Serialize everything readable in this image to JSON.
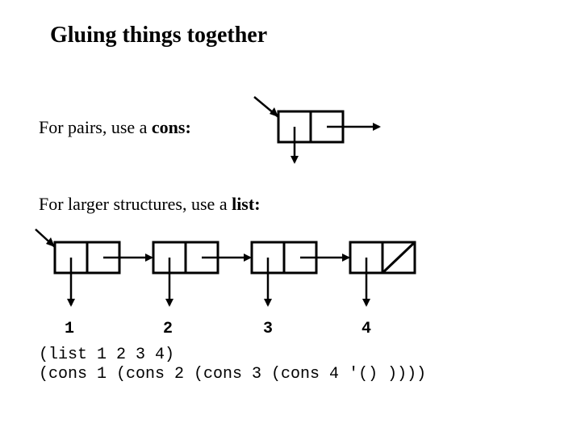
{
  "title": "Gluing things together",
  "line_pairs_prefix": "For pairs, use a ",
  "line_pairs_bold": "cons:",
  "line_list_prefix": "For larger structures, use a ",
  "line_list_bold": "list:",
  "labels": {
    "n1": "1",
    "n2": "2",
    "n3": "3",
    "n4": "4"
  },
  "code1": "(list 1 2 3 4)",
  "code2": "(cons 1 (cons 2 (cons 3 (cons 4 '() ))))"
}
